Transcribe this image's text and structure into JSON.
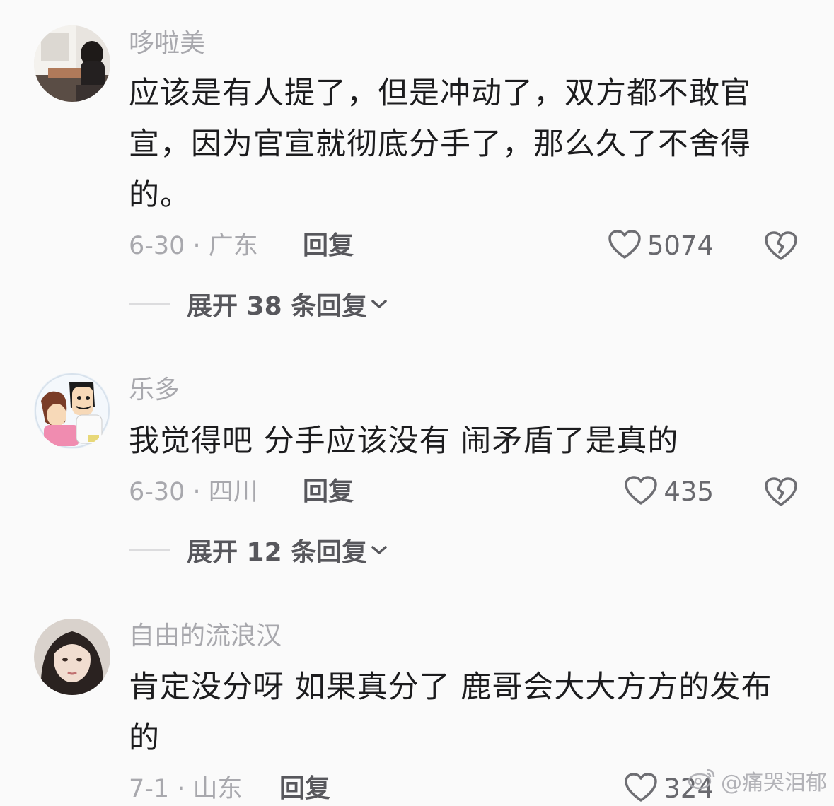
{
  "comments": [
    {
      "username": "哆啦美",
      "text": "应该是有人提了，但是冲动了，双方都不敢官宣，因为官宣就彻底分手了，那么久了不舍得的。",
      "meta": "6-30 · 广东",
      "reply_label": "回复",
      "likes": "5074",
      "expand_label": "展开 38 条回复"
    },
    {
      "username": "乐多",
      "text": "我觉得吧 分手应该没有 闹矛盾了是真的",
      "meta": "6-30 · 四川",
      "reply_label": "回复",
      "likes": "435",
      "expand_label": "展开 12 条回复"
    },
    {
      "username": "自由的流浪汉",
      "text": "肯定没分呀 如果真分了 鹿哥会大大方方的发布的",
      "meta": "7-1 · 山东",
      "reply_label": "回复",
      "likes": "324"
    }
  ],
  "watermark": {
    "text": "@痛哭泪郁",
    "icon": "weibo-icon"
  },
  "icons": {
    "like": "heart-outline-icon",
    "dislike": "broken-heart-icon",
    "expand": "chevron-down-icon"
  }
}
